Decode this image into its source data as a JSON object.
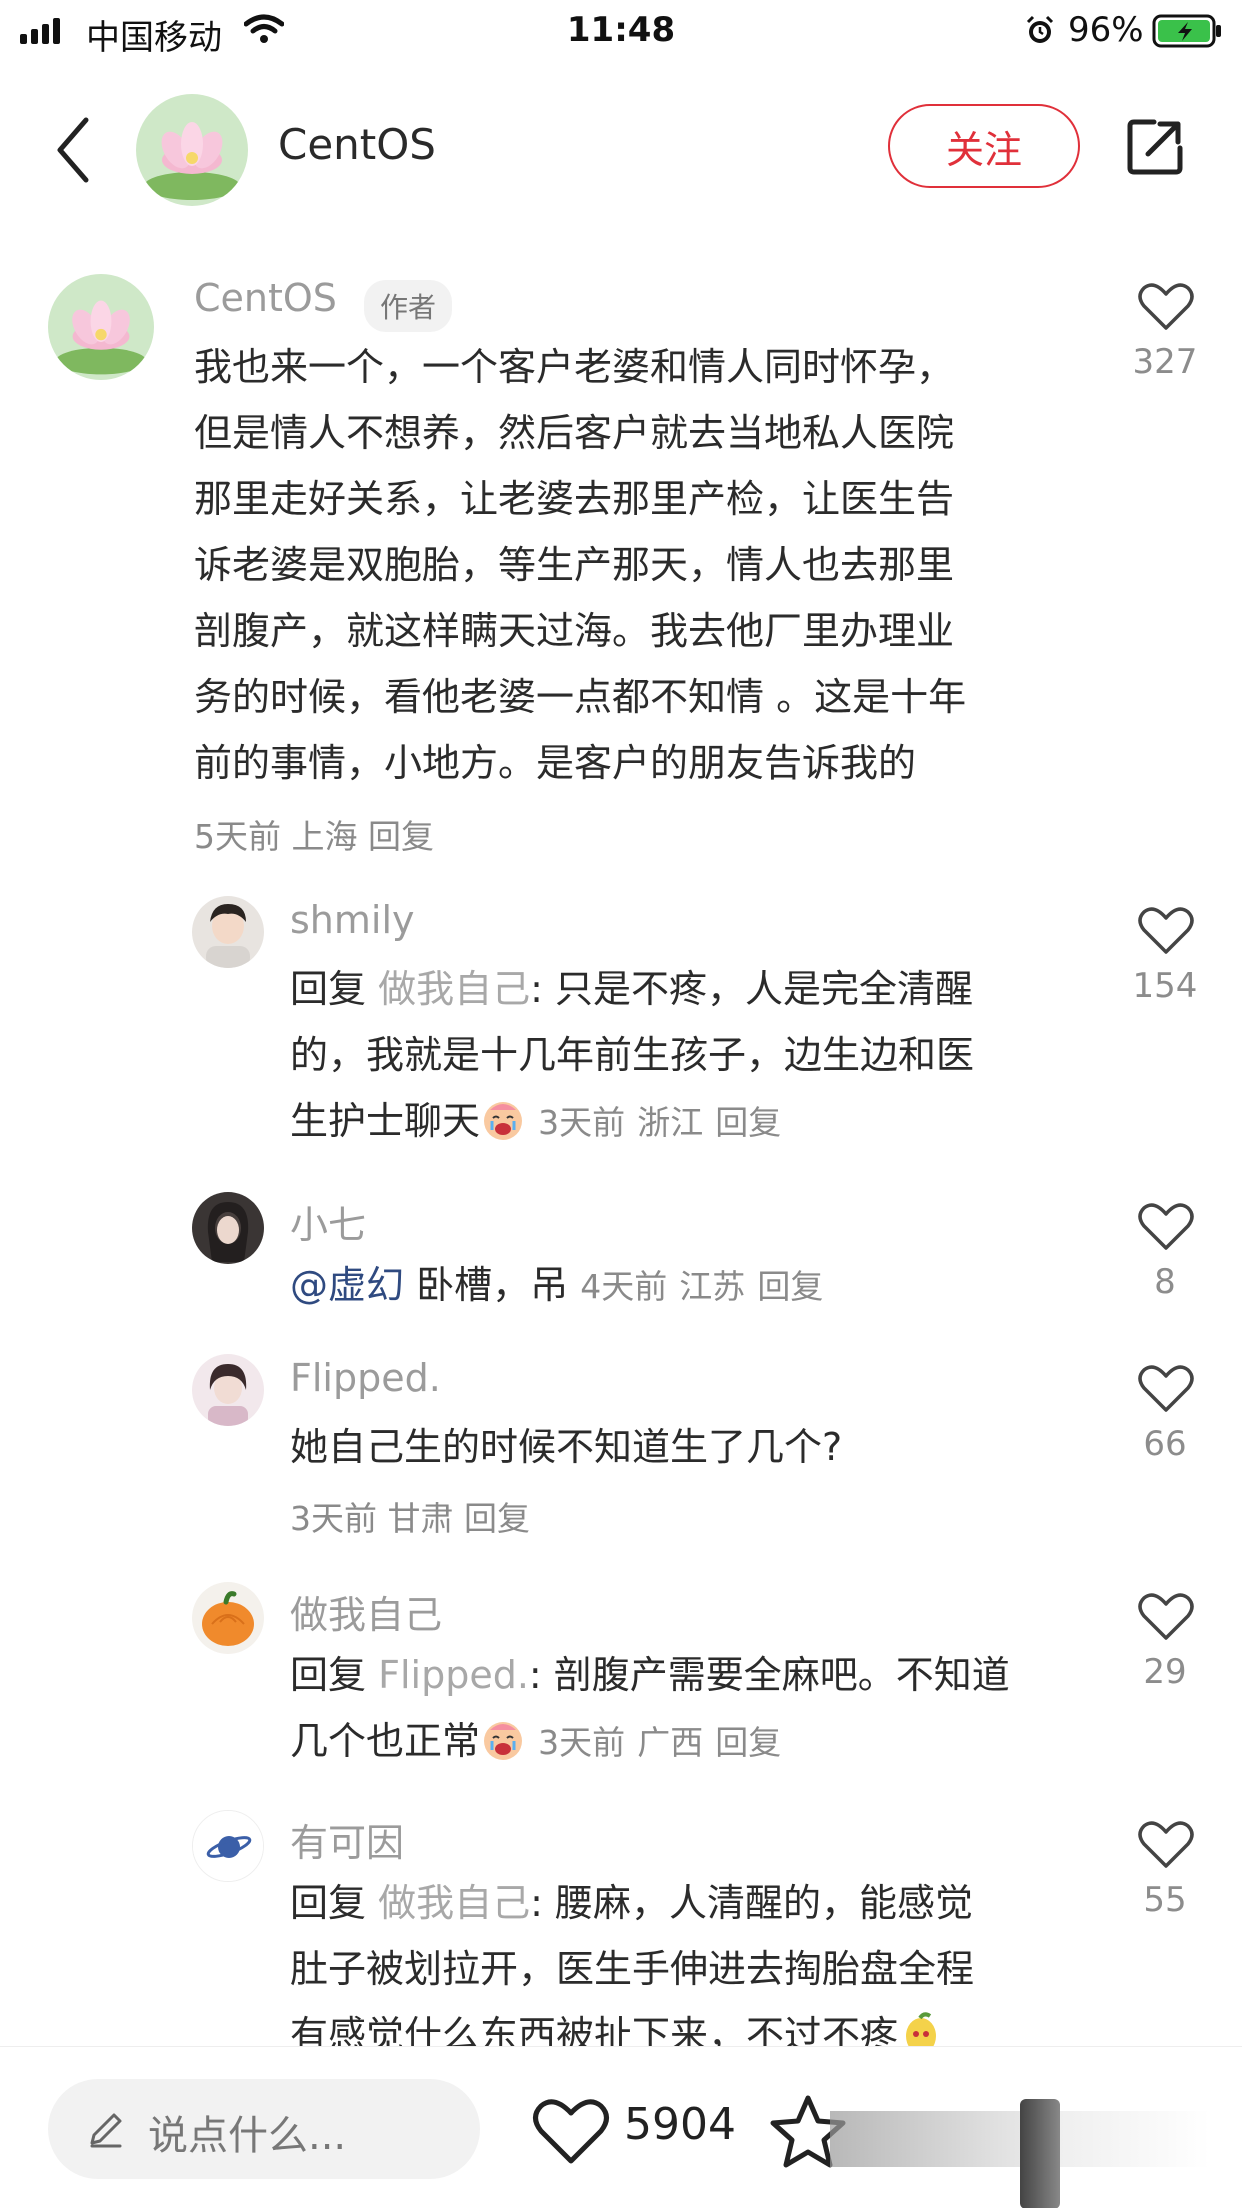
{
  "status_bar": {
    "carrier": "中国移动",
    "time": "11:48",
    "battery": "96%"
  },
  "header": {
    "title": "CentOS",
    "follow_label": "关注"
  },
  "comments": [
    {
      "name": "CentOS",
      "badge": "作者",
      "lines": [
        "我也来一个，一个客户老婆和情人同时怀孕，",
        "但是情人不想养，然后客户就去当地私人医院",
        "那里走好关系，让老婆去那里产检，让医生告",
        "诉老婆是双胞胎，等生产那天，情人也去那里",
        "剖腹产，就这样瞒天过海。我去他厂里办理业",
        "务的时候，看他老婆一点都不知情 。这是十年",
        "前的事情，小地方。是客户的朋友告诉我的"
      ],
      "time": "5天前",
      "location": "上海",
      "reply": "回复",
      "likes": "327"
    },
    {
      "name": "shmily",
      "reply_prefix": "回复",
      "reply_to": "做我自己",
      "lines": [
        ": 只是不疼，人是完全清醒",
        "的，我就是十几年前生孩子，边生边和医",
        "生护士聊天"
      ],
      "time": "3天前",
      "location": "浙江",
      "reply": "回复",
      "likes": "154"
    },
    {
      "name": "小七",
      "mention": "@虚幻",
      "text": " 卧槽，吊",
      "time": "4天前",
      "location": "江苏",
      "reply": "回复",
      "likes": "8"
    },
    {
      "name": "Flipped.",
      "text": "她自己生的时候不知道生了几个?",
      "time": "3天前",
      "location": "甘肃",
      "reply": "回复",
      "likes": "66"
    },
    {
      "name": "做我自己",
      "reply_prefix": "回复",
      "reply_to": "Flipped.",
      "lines": [
        ": 剖腹产需要全麻吧。不知道",
        "几个也正常"
      ],
      "time": "3天前",
      "location": "广西",
      "reply": "回复",
      "likes": "29"
    },
    {
      "name": "有可因",
      "reply_prefix": "回复",
      "reply_to": "做我自己",
      "lines": [
        ": 腰麻，人清醒的，能感觉",
        "肚子被划拉开，医生手伸进去掏胎盘全程",
        "有感觉什么东西被扯下来，不过不疼"
      ],
      "likes": "55"
    }
  ],
  "bottom_bar": {
    "placeholder": "说点什么...",
    "like_count": "5904"
  }
}
